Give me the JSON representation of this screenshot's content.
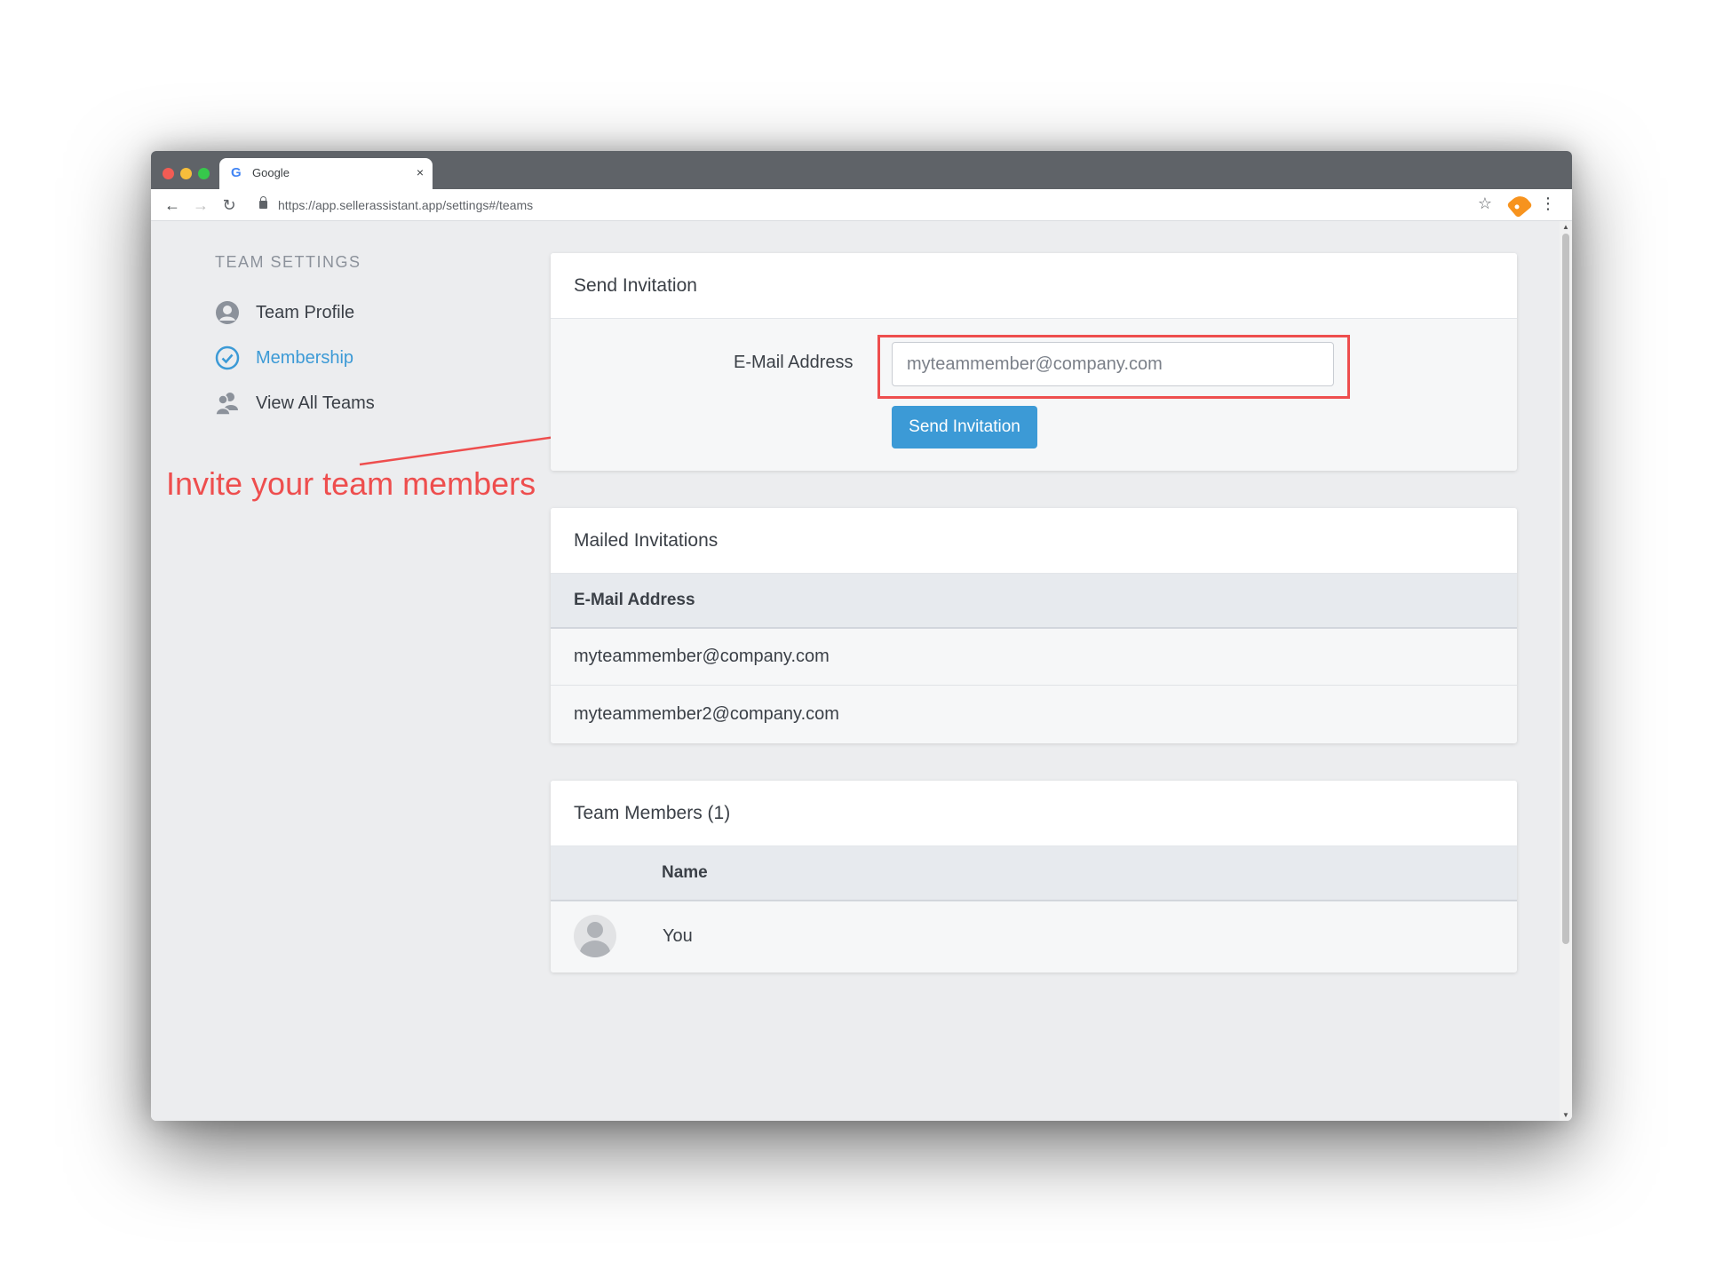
{
  "browser": {
    "tab_title": "Google",
    "tab_favicon": "G",
    "tab_close": "×",
    "url": "https://app.sellerassistant.app/settings#/teams"
  },
  "sidebar": {
    "heading": "TEAM SETTINGS",
    "items": [
      {
        "label": "Team Profile",
        "icon": "user-circle-icon",
        "active": false
      },
      {
        "label": "Membership",
        "icon": "check-circle-icon",
        "active": true
      },
      {
        "label": "View All Teams",
        "icon": "users-icon",
        "active": false
      }
    ]
  },
  "annotation": {
    "text": "Invite your team members",
    "color": "#ee4e4e"
  },
  "send_invitation": {
    "title": "Send Invitation",
    "email_label": "E-Mail Address",
    "email_placeholder": "myteammember@company.com",
    "button_label": "Send Invitation"
  },
  "mailed_invitations": {
    "title": "Mailed Invitations",
    "column": "E-Mail Address",
    "rows": [
      "myteammember@company.com",
      "myteammember2@company.com"
    ]
  },
  "team_members": {
    "title": "Team Members (1)",
    "column": "Name",
    "rows": [
      {
        "name": "You"
      }
    ]
  },
  "colors": {
    "accent": "#3c9ad6",
    "annotation": "#ee4e4e",
    "page_bg": "#ecedef"
  }
}
